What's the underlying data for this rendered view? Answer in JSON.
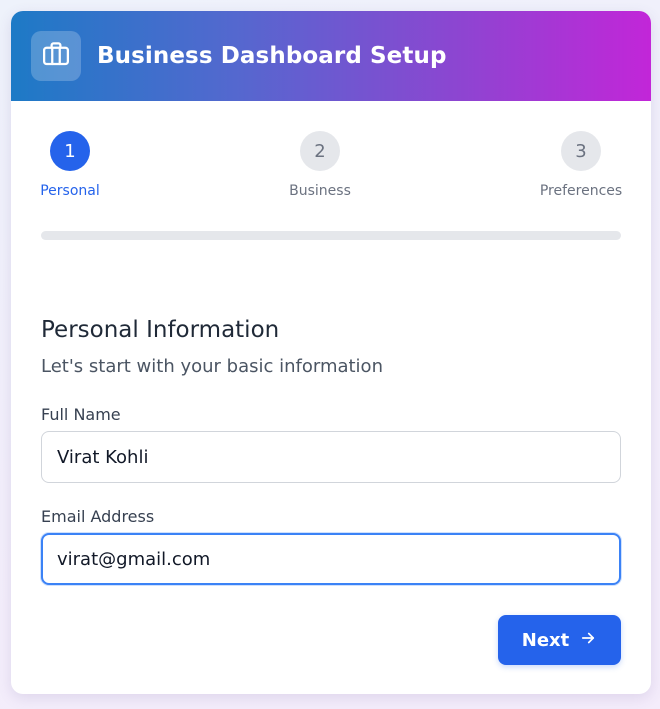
{
  "header": {
    "title": "Business Dashboard Setup",
    "icon": "briefcase-icon"
  },
  "steps": [
    {
      "number": "1",
      "label": "Personal",
      "state": "active"
    },
    {
      "number": "2",
      "label": "Business",
      "state": "inactive"
    },
    {
      "number": "3",
      "label": "Preferences",
      "state": "inactive"
    }
  ],
  "progress": {
    "fraction": 0
  },
  "form": {
    "title": "Personal Information",
    "subtitle": "Let's start with your basic information",
    "full_name": {
      "label": "Full Name",
      "value": "Virat Kohli"
    },
    "email": {
      "label": "Email Address",
      "value": "virat@gmail.com"
    }
  },
  "actions": {
    "next_label": "Next",
    "next_icon": "arrow-right-icon"
  },
  "colors": {
    "primary": "#2563eb",
    "header_gradient_start": "#1d7ac6",
    "header_gradient_end": "#c226d8",
    "inactive_step": "#e5e7eb"
  }
}
